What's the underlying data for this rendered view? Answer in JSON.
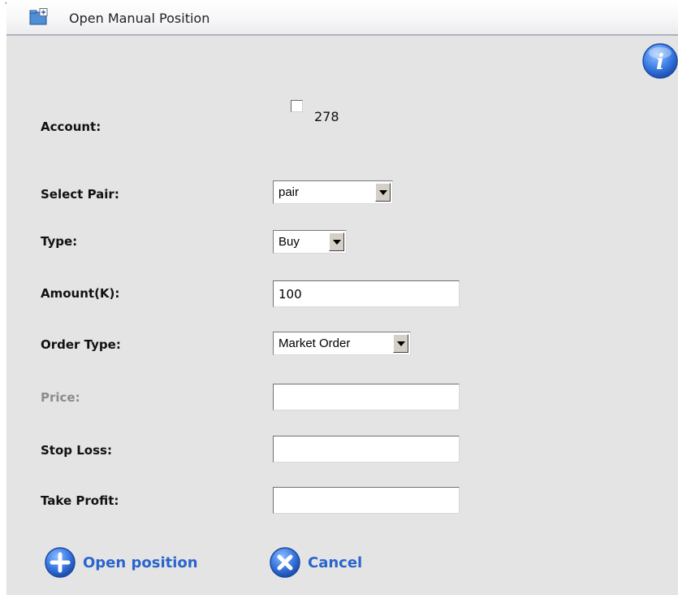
{
  "dialog": {
    "title": "Open Manual Position",
    "corner_mark": "'"
  },
  "form": {
    "account": {
      "label": "Account:",
      "option": "278",
      "checked": false
    },
    "pair": {
      "label": "Select Pair:",
      "selected": "pair"
    },
    "type": {
      "label": "Type:",
      "selected": "Buy"
    },
    "amount": {
      "label": "Amount(K):",
      "value": "100"
    },
    "order_type": {
      "label": "Order Type:",
      "selected": "Market Order"
    },
    "price": {
      "label": "Price:",
      "value": "",
      "disabled": true
    },
    "stop_loss": {
      "label": "Stop Loss:",
      "value": ""
    },
    "take_profit": {
      "label": "Take Profit:",
      "value": ""
    }
  },
  "actions": {
    "open_label": "Open position",
    "cancel_label": "Cancel"
  },
  "icons": {
    "title": "folder-add-icon",
    "info": "info-icon",
    "open": "plus-circle-icon",
    "cancel": "x-circle-icon"
  },
  "colors": {
    "link_blue": "#2a64cc",
    "panel_bg": "#e4e4e4",
    "disabled_label": "#8c8c8c"
  }
}
